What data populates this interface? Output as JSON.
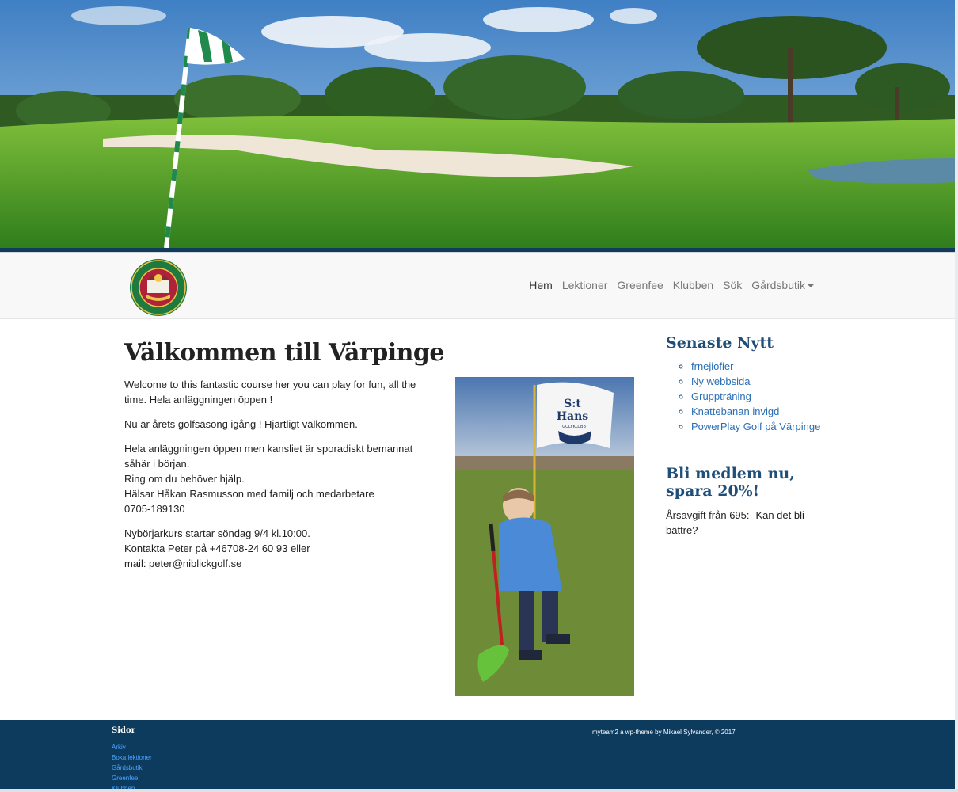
{
  "nav": {
    "items": [
      {
        "label": "Hem"
      },
      {
        "label": "Lektioner"
      },
      {
        "label": "Greenfee"
      },
      {
        "label": "Klubben"
      },
      {
        "label": "Sök"
      },
      {
        "label": "Gårdsbutik"
      }
    ]
  },
  "logo": {
    "text_top": "VÄRPINGE",
    "text_bottom": "GOLFBANA",
    "year_left": "19",
    "year_right": "91"
  },
  "main": {
    "title": "Välkommen till Värpinge",
    "paragraphs": [
      "Welcome to this fantastic course her you can play for fun, all the time. Hela anläggningen öppen !",
      "Nu är årets golfsäsong igång ! Hjärtligt välkommen.",
      [
        "Hela anläggningen öppen men kansliet är sporadiskt bemannat såhär i början.",
        "Ring om du behöver hjälp.",
        "Hälsar Håkan Rasmusson med familj och medarbetare",
        "0705-189130"
      ],
      [
        "Nybörjarkurs startar söndag 9/4 kl.10:00.",
        "Kontakta Peter på +46708-24 60 93 eller",
        "mail: peter@niblickgolf.se"
      ]
    ],
    "photo_flag": {
      "line1": "S:t",
      "line2": "Hans",
      "line3": "GOLFKLUBB"
    }
  },
  "sidebar": {
    "news_title": "Senaste Nytt",
    "news": [
      "frnejiofier",
      "Ny webbsida",
      "Gruppträning",
      "Knattebanan invigd",
      "PowerPlay Golf på Värpinge"
    ],
    "promo_title": "Bli medlem nu, spara 20%!",
    "promo_text": "Årsavgift från 695:- Kan det bli bättre?"
  },
  "footer": {
    "title": "Sidor",
    "links": [
      "Arkiv",
      "Boka lektioner",
      "Gårdsbutik",
      "Greenfee",
      "Klubben"
    ],
    "credit": "myteam2 a wp-theme by Mikael Sylvander, © 2017"
  },
  "colors": {
    "brand": "#1f4e78",
    "link": "#2a6fb5",
    "footer_bg": "#0d3b5e"
  }
}
